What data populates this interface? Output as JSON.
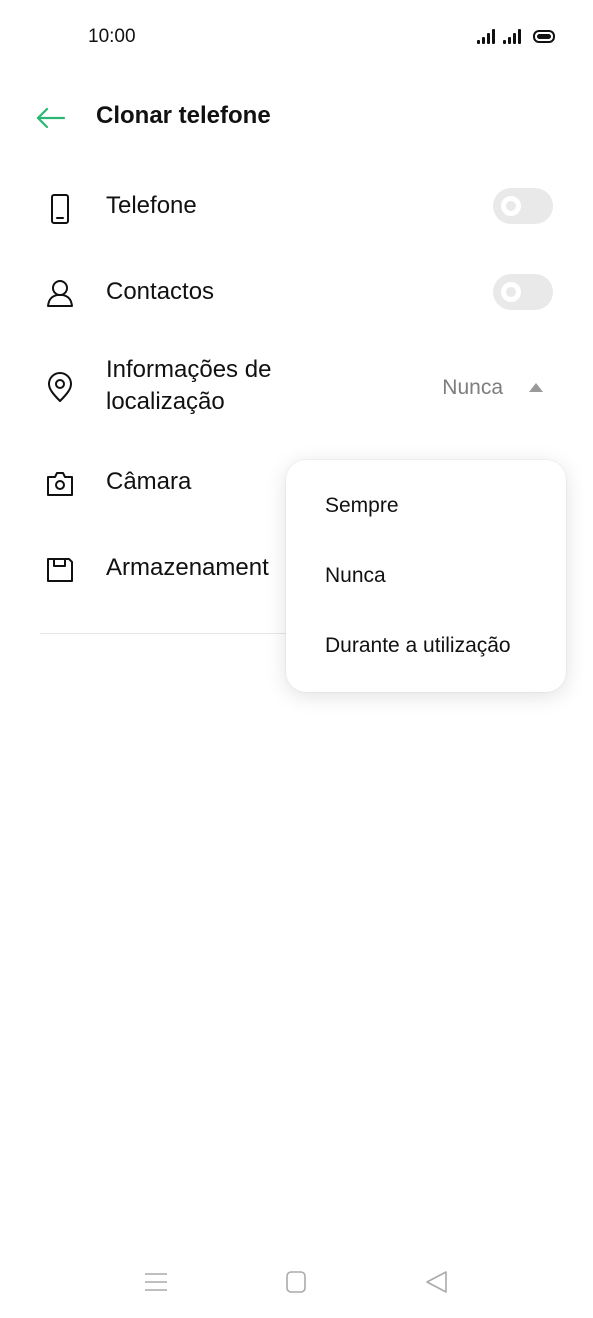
{
  "status_bar": {
    "time": "10:00",
    "icons": [
      "signal-icon",
      "signal-icon",
      "battery-icon"
    ]
  },
  "header": {
    "title": "Clonar telefone",
    "back_icon": "arrow-left-icon",
    "accent": "#2bb673"
  },
  "settings": [
    {
      "icon": "phone-icon",
      "label": "Telefone",
      "control": "toggle",
      "checked": false
    },
    {
      "icon": "contact-icon",
      "label": "Contactos",
      "control": "toggle",
      "checked": false
    },
    {
      "icon": "location-pin-icon",
      "label_line1": "Informações de",
      "label_line2": "localização",
      "control": "dropdown",
      "value": "Nunca"
    },
    {
      "icon": "camera-icon",
      "label": "Câmara"
    },
    {
      "icon": "storage-icon",
      "label": "Armazenament"
    }
  ],
  "dropdown": {
    "options": [
      "Sempre",
      "Nunca",
      "Durante a utilização"
    ]
  },
  "nav_bar": {
    "icons": [
      "menu-icon",
      "home-icon",
      "back-triangle-icon"
    ]
  }
}
